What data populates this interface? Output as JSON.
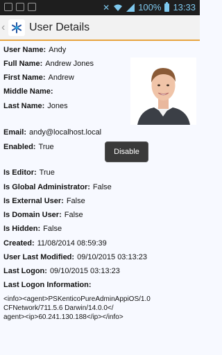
{
  "status_bar": {
    "battery": "100%",
    "time": "13:33"
  },
  "action_bar": {
    "title": "User Details"
  },
  "fields": [
    {
      "label": "User Name:",
      "value": "Andy"
    },
    {
      "label": "Full Name:",
      "value": "Andrew Jones"
    },
    {
      "label": "First Name:",
      "value": "Andrew"
    },
    {
      "label": "Middle Name:",
      "value": ""
    },
    {
      "label": "Last Name:",
      "value": "Jones"
    },
    {
      "label": "Email:",
      "value": "andy@localhost.local"
    },
    {
      "label": "Enabled:",
      "value": "True"
    },
    {
      "label": "Is Editor:",
      "value": "True"
    },
    {
      "label": "Is Global Administrator:",
      "value": "False"
    },
    {
      "label": "Is External User:",
      "value": "False"
    },
    {
      "label": "Is Domain User:",
      "value": "False"
    },
    {
      "label": "Is Hidden:",
      "value": "False"
    },
    {
      "label": "Created:",
      "value": "11/08/2014 08:59:39"
    },
    {
      "label": "User Last Modified:",
      "value": "09/10/2015 03:13:23"
    },
    {
      "label": "Last Logon:",
      "value": "09/10/2015 03:13:23"
    },
    {
      "label": "Last Logon Information:",
      "value": ""
    }
  ],
  "toast": {
    "label": "Disable"
  },
  "logon_info": "<info><agent>PSKenticoPureAdminAppiOS/1.0\nCFNetwork/711.5.6 Darwin/14.0.0</\nagent><ip>60.241.130.188</ip></info>"
}
